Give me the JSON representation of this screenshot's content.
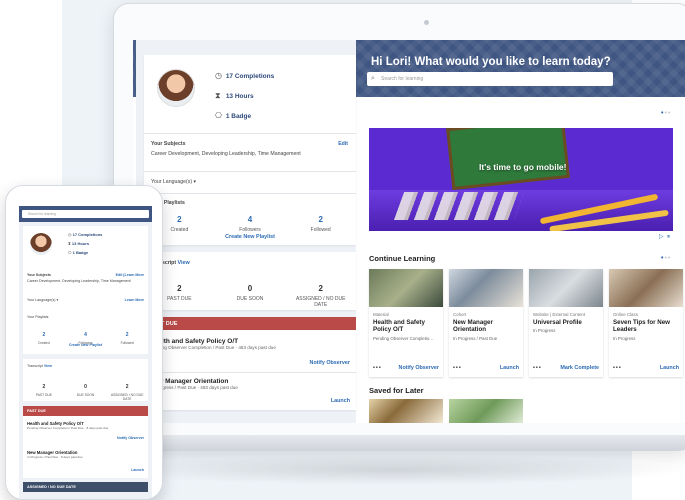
{
  "laptop": {
    "greeting": "Hi Lori! What would you like to learn today?",
    "search_placeholder": "Search for learning",
    "profile": {
      "completions_num": "17",
      "completions_label": "Completions",
      "hours_num": "13",
      "hours_label": "Hours",
      "badge_num": "1",
      "badge_label": "Badge"
    },
    "subjects": {
      "label": "Your Subjects",
      "edit": "Edit",
      "value": "Career Development, Developing Leadership, Time Management"
    },
    "languages": {
      "label": "Your Language(s)"
    },
    "playlists": {
      "label": "Your Playlists",
      "counts": [
        {
          "num": "2",
          "label": "Created"
        },
        {
          "num": "4",
          "label": "Followers"
        },
        {
          "num": "2",
          "label": "Followed"
        }
      ],
      "create": "Create New Playlist"
    },
    "transcript": {
      "label": "Transcript",
      "view": "View",
      "counts": [
        {
          "num": "2",
          "label": "PAST DUE"
        },
        {
          "num": "0",
          "label": "DUE SOON"
        },
        {
          "num": "2",
          "label": "ASSIGNED / NO DUE DATE"
        }
      ]
    },
    "past_due": {
      "header": "PAST DUE",
      "items": [
        {
          "title": "Health and Safety Policy O/T",
          "sub": "Pending Observer Completion / Past Due · 483 days past due",
          "action": "Notify Observer"
        },
        {
          "title": "New Manager Orientation",
          "sub": "In Progress / Past Due · 483 days past due",
          "action": "Launch"
        }
      ]
    },
    "hero": {
      "caption": "It's time to go mobile!"
    },
    "continue": {
      "title": "Continue Learning",
      "cards": [
        {
          "type": "Material",
          "title": "Health and Safety Policy O/T",
          "status": "Pending Observer Completio...",
          "action": "Notify Observer"
        },
        {
          "type": "Cohort",
          "title": "New Manager Orientation",
          "status": "In Progress / Past Due",
          "action": "Launch"
        },
        {
          "type": "Website | External Content",
          "title": "Universal Profile",
          "status": "In Progress",
          "action": "Mark Complete"
        },
        {
          "type": "Online Class",
          "title": "Seven Tips for New Leaders",
          "status": "In Progress",
          "action": "Launch"
        }
      ]
    },
    "saved": {
      "title": "Saved for Later"
    },
    "more": "•••"
  },
  "phone": {
    "search_placeholder": "Search for learning",
    "completions": "17 Completions",
    "hours": "13 Hours",
    "badge": "1 Badge",
    "subjects_label": "Your Subjects",
    "subjects_edit": "Edit [Learn More",
    "subjects_value": "Career Development, Developing Leadership, Time Management",
    "languages_label": "Your Language(s)",
    "learn_more": "Learn More",
    "playlists_label": "Your Playlists",
    "playlists": [
      {
        "num": "2",
        "label": "Created"
      },
      {
        "num": "4",
        "label": "Followers"
      },
      {
        "num": "2",
        "label": "Followed"
      }
    ],
    "create": "Create New Playlist",
    "transcript_label": "Transcript",
    "transcript_view": "View",
    "transcript": [
      {
        "num": "2",
        "label": "PAST DUE"
      },
      {
        "num": "0",
        "label": "DUE SOON"
      },
      {
        "num": "2",
        "label": "ASSIGNED / NO DUE DATE"
      }
    ],
    "past_due": "PAST DUE",
    "items": [
      {
        "title": "Health and Safety Policy O/T",
        "sub": "Pending Observer Completion / Past Due · 8 days past due",
        "action": "Notify Observer"
      },
      {
        "title": "New Manager Orientation",
        "sub": "In Progress / Past Due · 8 days past due",
        "action": "Launch"
      }
    ],
    "assigned": "ASSIGNED / NO DUE DATE"
  },
  "colors": {
    "banner": "#3f5682",
    "accent": "#2c6bb3",
    "past_due": "#b94a48"
  }
}
